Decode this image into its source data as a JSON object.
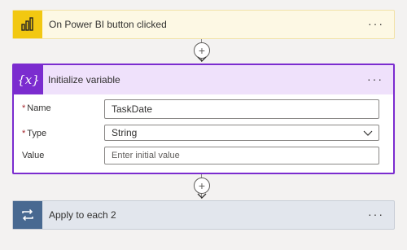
{
  "trigger": {
    "title": "On Power BI button clicked",
    "icon": "power-bi-icon",
    "menu": "···"
  },
  "init_variable": {
    "title": "Initialize variable",
    "icon": "variable-icon",
    "icon_glyph": "{x}",
    "menu": "···",
    "fields": {
      "name": {
        "label": "Name",
        "required": "*",
        "value": "TaskDate"
      },
      "type": {
        "label": "Type",
        "required": "*",
        "value": "String"
      },
      "value": {
        "label": "Value",
        "placeholder": "Enter initial value"
      }
    }
  },
  "apply_each": {
    "title": "Apply to each 2",
    "icon": "loop-icon",
    "menu": "···"
  },
  "connectors": {
    "plus": "+"
  },
  "colors": {
    "trigger_icon": "#f2c811",
    "variable_accent": "#7b2ccf",
    "variable_header": "#efe1fb",
    "loop_icon": "#486991"
  }
}
